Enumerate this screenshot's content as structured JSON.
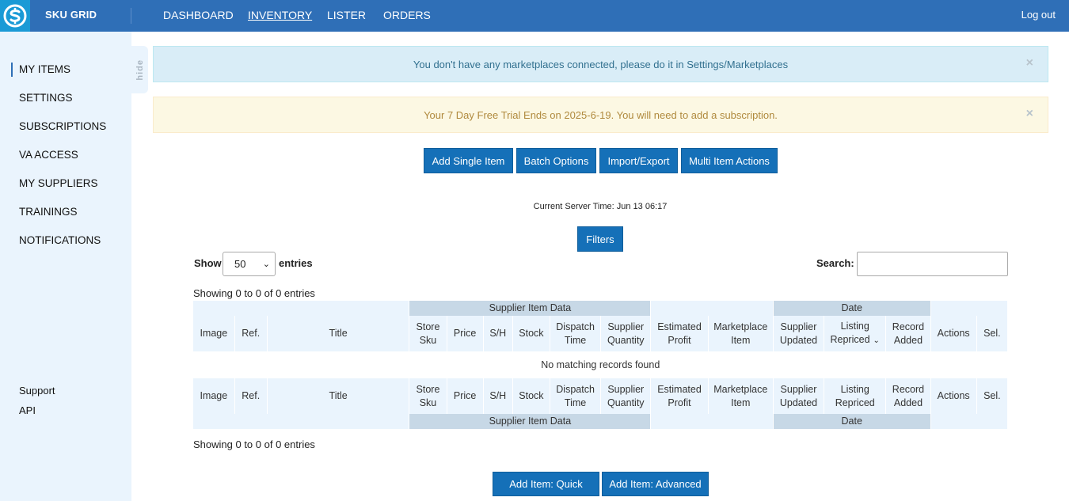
{
  "brand": "SKU GRID",
  "nav": {
    "items": [
      "DASHBOARD",
      "INVENTORY",
      "LISTER",
      "ORDERS"
    ],
    "active": "INVENTORY",
    "logout": "Log out"
  },
  "sidebar": {
    "items": [
      "MY ITEMS",
      "SETTINGS",
      "SUBSCRIPTIONS",
      "VA ACCESS",
      "MY SUPPLIERS",
      "TRAININGS",
      "NOTIFICATIONS"
    ],
    "links": [
      "Support",
      "API"
    ],
    "hide_label": "hide"
  },
  "alerts": {
    "info": "You don't have any marketplaces connected, please do it in Settings/Marketplaces",
    "warning": "Your 7 Day Free Trial Ends on 2025-6-19. You will need to add a subscription.",
    "close": "×"
  },
  "actions": [
    "Add Single Item",
    "Batch Options",
    "Import/Export",
    "Multi Item Actions"
  ],
  "server_time": "Current Server Time: Jun 13 06:17",
  "filters_label": "Filters",
  "length_control": {
    "show": "Show",
    "value": "50",
    "entries": "entries"
  },
  "search_label": "Search:",
  "info_text": "Showing 0 to 0 of 0 entries",
  "table": {
    "group_supplier": "Supplier Item Data",
    "group_date": "Date",
    "columns": [
      "Image",
      "Ref.",
      "Title",
      "Store Sku",
      "Price",
      "S/H",
      "Stock",
      "Dispatch Time",
      "Supplier Quantity",
      "Estimated Profit",
      "Marketplace Item",
      "Supplier Updated",
      "Listing Repriced",
      "Record Added",
      "Actions",
      "Sel."
    ],
    "empty_message": "No matching records found"
  },
  "bottom_actions": [
    "Add Item: Quick",
    "Add Item: Advanced"
  ],
  "colors": {
    "topbar": "#2f6fb7",
    "button": "#1570b8",
    "sidebar": "#eaf4fd"
  }
}
